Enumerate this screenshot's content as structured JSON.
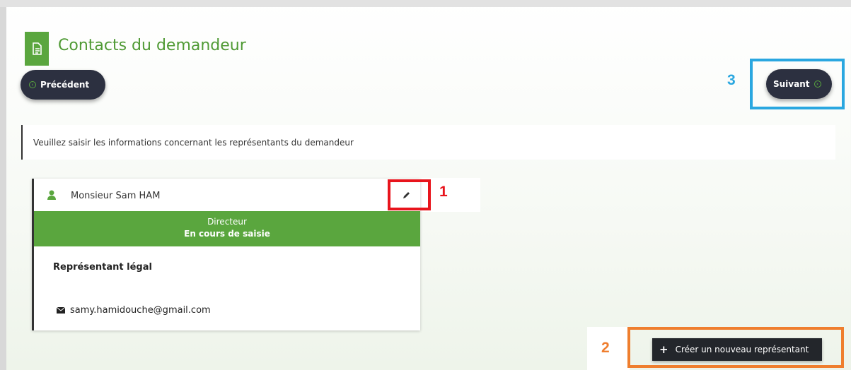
{
  "page": {
    "title": "Contacts du demandeur",
    "info_text": "Veuillez saisir les informations concernant les représentants du demandeur"
  },
  "nav": {
    "prev_label": "Précédent",
    "next_label": "Suivant"
  },
  "card": {
    "name": "Monsieur Sam HAM",
    "role": "Directeur",
    "status": "En cours de saisie",
    "representative_type": "Représentant légal",
    "email": "samy.hamidouche@gmail.com"
  },
  "actions": {
    "create_label": "Créer un nouveau représentant"
  },
  "annotations": {
    "n1": "1",
    "n2": "2",
    "n3": "3"
  },
  "colors": {
    "accent_green": "#5aa63e",
    "dark_button": "#2c3040",
    "highlight_red": "#e8141c",
    "highlight_orange": "#ef7e2e",
    "highlight_blue": "#2aa7e0"
  },
  "icons": [
    "document-icon",
    "arrow-circle-left-icon",
    "arrow-circle-right-icon",
    "user-icon",
    "pencil-icon",
    "envelope-icon",
    "plus-icon"
  ]
}
